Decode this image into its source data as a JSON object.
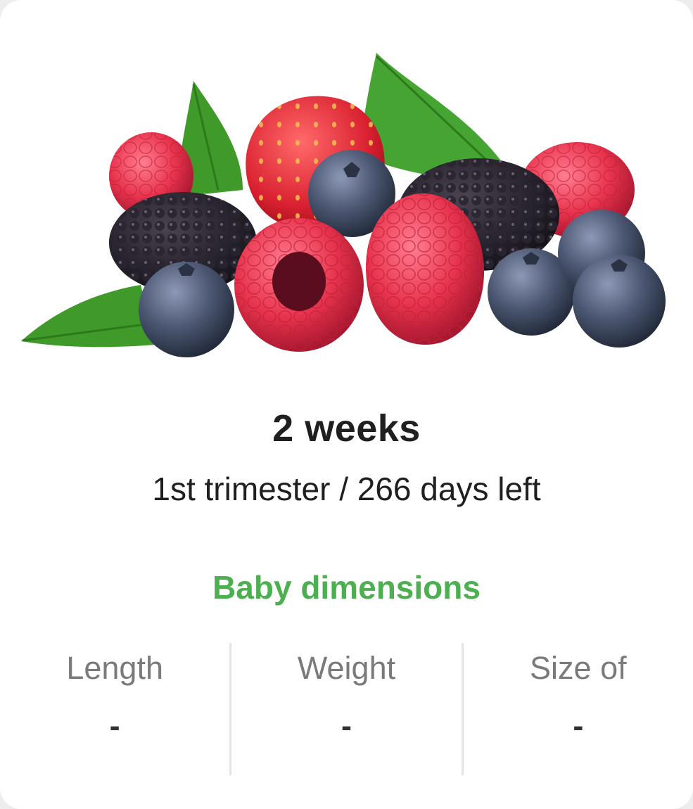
{
  "header": {
    "image_icon": "mixed-berries-illustration",
    "week": "2 weeks",
    "subtitle": "1st trimester / 266 days left"
  },
  "dimensions": {
    "title": "Baby dimensions",
    "stats": [
      {
        "label": "Length",
        "value": "-"
      },
      {
        "label": "Weight",
        "value": "-"
      },
      {
        "label": "Size of",
        "value": "-"
      }
    ]
  },
  "colors": {
    "accent": "#4caf50",
    "text": "#1f1f1f",
    "muted": "#7a7a7a",
    "raspberry": "#e8334d",
    "blueberry": "#4a5670",
    "blackberry": "#1c1a22",
    "leaf": "#3f9a2a"
  }
}
